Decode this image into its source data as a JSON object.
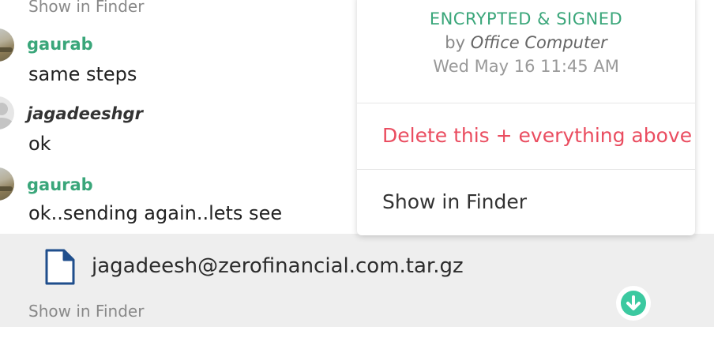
{
  "messages": {
    "top_link": "Show in Finder",
    "items": [
      {
        "author": "gaurab",
        "text": "same steps",
        "avatar": "avatar-photo"
      },
      {
        "author": "jagadeeshgr",
        "text": "ok",
        "avatar": "default-avatar-icon"
      },
      {
        "author": "gaurab",
        "text": "ok..sending again..lets see",
        "avatar": "avatar-photo"
      }
    ]
  },
  "attachment": {
    "filename": "jagadeesh@zerofinancial.com.tar.gz",
    "icon": "document-icon",
    "finder_link": "Show in Finder",
    "download_icon": "download-arrow-icon",
    "download_color": "#3bc9a0"
  },
  "context_menu": {
    "encryption_status": "ENCRYPTED & SIGNED",
    "by_prefix": "by",
    "device": "Office Computer",
    "date": "Wed May 16 11:45 AM",
    "delete_label": "Delete this + everything above",
    "show_in_finder_label": "Show in Finder"
  },
  "colors": {
    "accent_green": "#3aa67a",
    "danger_red": "#ea4d60",
    "file_icon_blue": "#1f4e8c"
  }
}
